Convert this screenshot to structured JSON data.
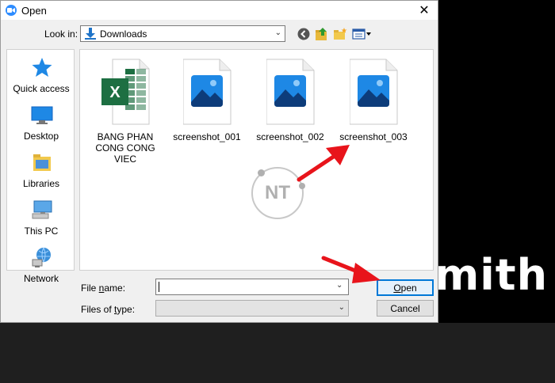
{
  "window": {
    "title": "Open",
    "close_glyph": "✕"
  },
  "background": {
    "text": "mith"
  },
  "lookin": {
    "label": "Look in:",
    "value": "Downloads"
  },
  "places": [
    {
      "label": "Quick access",
      "icon": "quick-access-star-icon"
    },
    {
      "label": "Desktop",
      "icon": "desktop-icon"
    },
    {
      "label": "Libraries",
      "icon": "libraries-icon"
    },
    {
      "label": "This PC",
      "icon": "this-pc-icon"
    },
    {
      "label": "Network",
      "icon": "network-icon"
    }
  ],
  "files": [
    {
      "label_line1": "BANG PHAN",
      "label_line2": "CONG CONG VIEC",
      "icon": "excel-file-icon"
    },
    {
      "label_line1": "screenshot_001",
      "icon": "image-file-icon"
    },
    {
      "label_line1": "screenshot_002",
      "icon": "image-file-icon"
    },
    {
      "label_line1": "screenshot_003",
      "icon": "image-file-icon"
    }
  ],
  "watermark": {
    "text": "NT"
  },
  "filename": {
    "label_pre": "File ",
    "label_ul": "n",
    "label_post": "ame:",
    "value": ""
  },
  "filetype": {
    "label_pre": "Files of ",
    "label_ul": "t",
    "label_post": "ype:",
    "value": ""
  },
  "buttons": {
    "open_ul": "O",
    "open_rest": "pen",
    "cancel": "Cancel"
  },
  "colors": {
    "accent": "#0078d7",
    "arrow": "#e8141b",
    "excel_green": "#1d6f42",
    "image_blue": "#1e88e5"
  }
}
